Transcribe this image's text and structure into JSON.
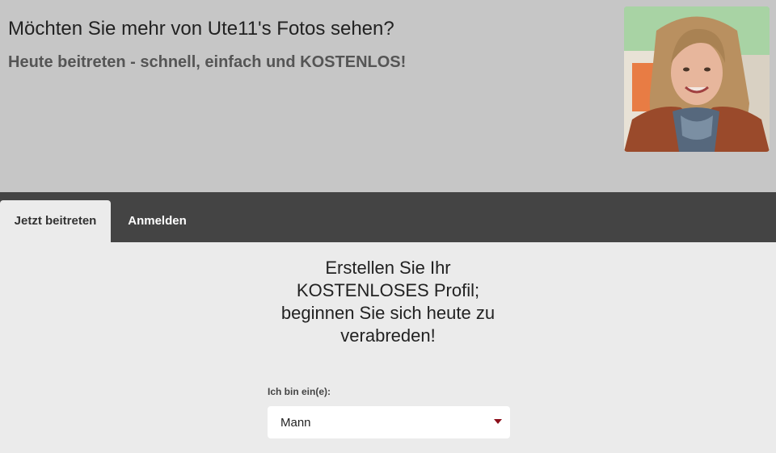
{
  "header": {
    "title": "Möchten Sie mehr von Ute11's Fotos sehen?",
    "subtitle": "Heute beitreten - schnell, einfach und KOSTENLOS!",
    "photo_icon": "profile-photo"
  },
  "tabs": [
    {
      "label": "Jetzt beitreten",
      "active": true
    },
    {
      "label": "Anmelden",
      "active": false
    }
  ],
  "signup": {
    "headline_lines": [
      "Erstellen Sie Ihr",
      "KOSTENLOSES Profil;",
      "beginnen Sie sich heute zu",
      "verabreden!"
    ],
    "gender_label": "Ich bin ein(e):",
    "gender_value": "Mann"
  },
  "colors": {
    "header_bg": "#c6c6c6",
    "tabbar_bg": "#444444",
    "page_bg": "#ebebeb",
    "accent": "#8b0e1a"
  }
}
